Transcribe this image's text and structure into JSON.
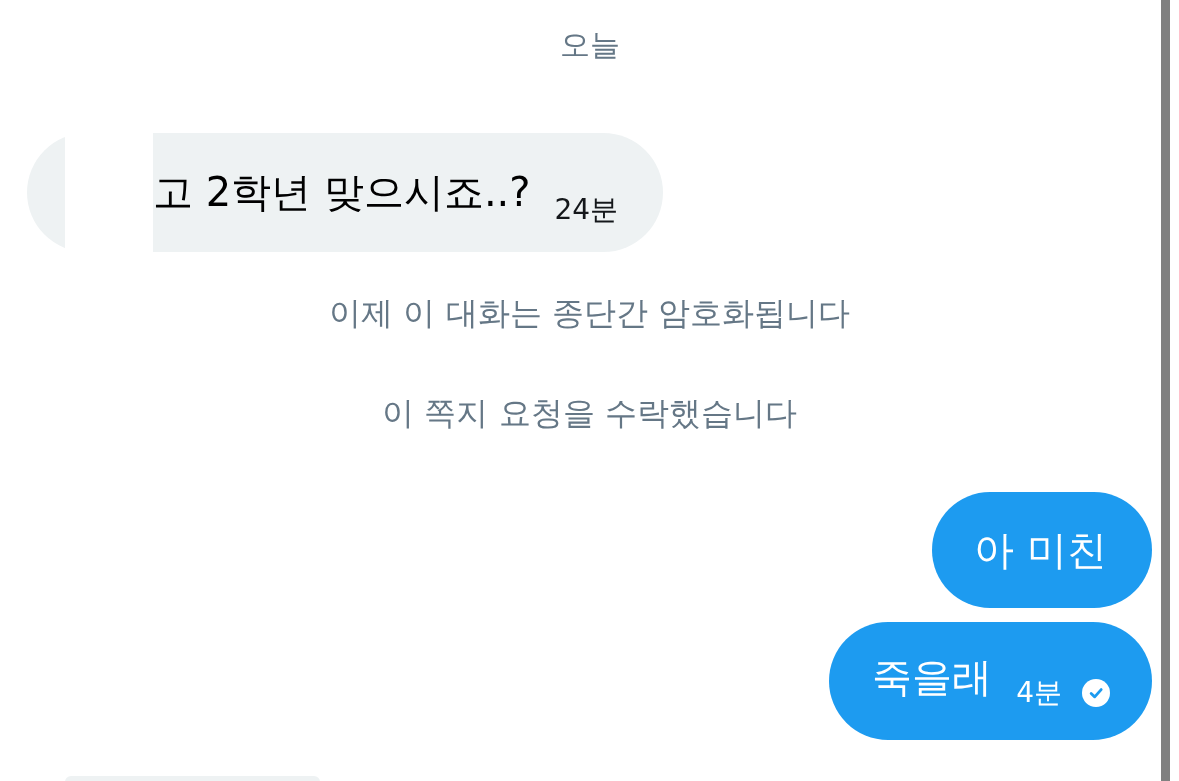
{
  "date_divider": "오늘",
  "messages": [
    {
      "kind": "received",
      "text": "고 2학년 맞으시죠..?",
      "time": "24분",
      "redacted": true
    },
    {
      "kind": "system",
      "text": "이제 이 대화는 종단간 암호화됩니다"
    },
    {
      "kind": "system",
      "text": "이 쪽지 요청을 수락했습니다"
    },
    {
      "kind": "sent",
      "text": "아 미친"
    },
    {
      "kind": "sent",
      "text": "죽을래",
      "time": "4분",
      "read": true
    },
    {
      "kind": "clipped"
    }
  ]
}
